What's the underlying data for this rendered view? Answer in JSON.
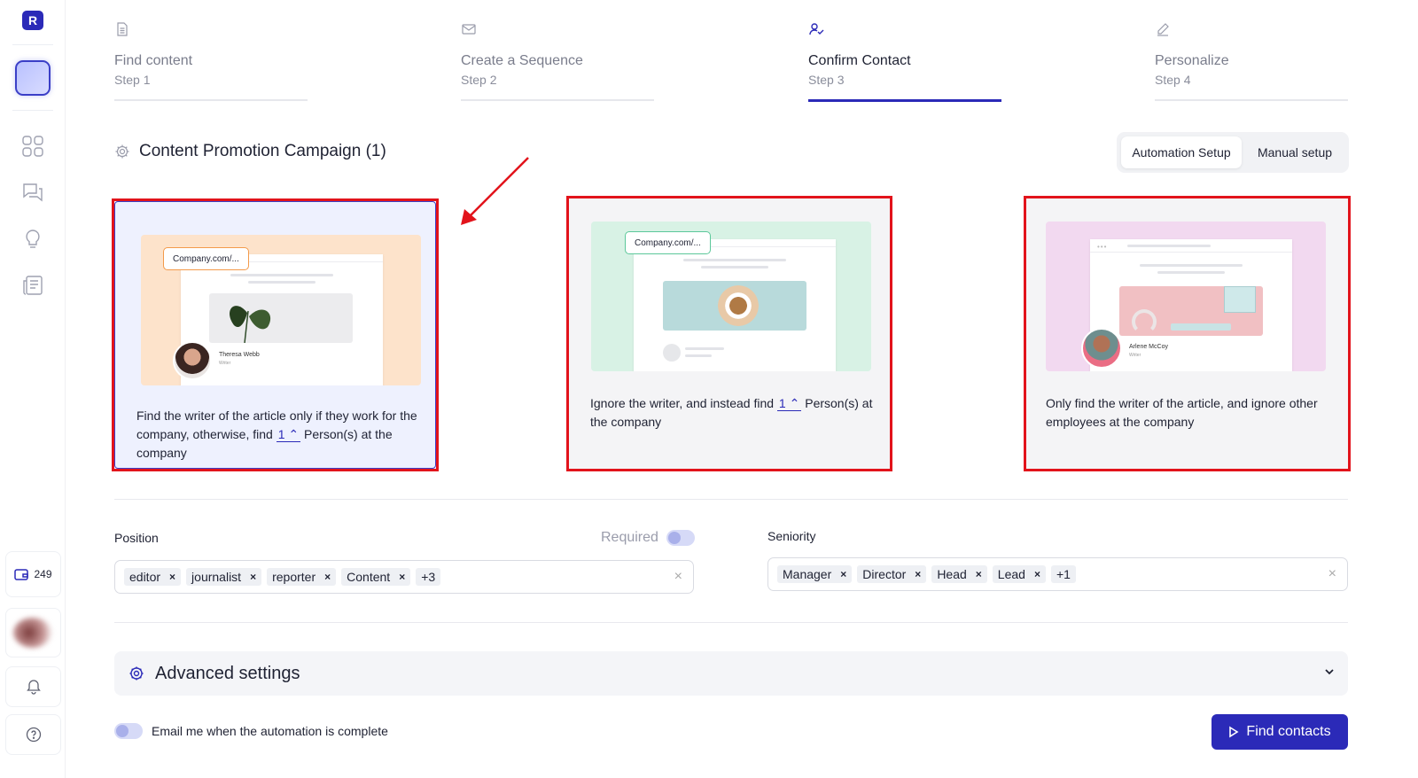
{
  "sidebar": {
    "logo": "R",
    "icons": [
      "grid-icon",
      "chat-icon",
      "lightbulb-icon",
      "newspaper-icon"
    ],
    "credits": "249"
  },
  "steps": [
    {
      "title": "Find content",
      "sub": "Step 1",
      "icon": "document-icon",
      "active": false
    },
    {
      "title": "Create a Sequence",
      "sub": "Step 2",
      "icon": "mail-icon",
      "active": false
    },
    {
      "title": "Confirm Contact",
      "sub": "Step 3",
      "icon": "user-check-icon",
      "active": true
    },
    {
      "title": "Personalize",
      "sub": "Step 4",
      "icon": "pencil-icon",
      "active": false
    }
  ],
  "campaign": {
    "title": "Content Promotion Campaign (1)"
  },
  "setup": {
    "automation": "Automation Setup",
    "manual": "Manual setup"
  },
  "cards": [
    {
      "url": "Company.com/...",
      "writer_name": "Theresa Webb",
      "writer_role": "Writer",
      "text_a": "Find the writer of the article only if they work for the company, otherwise, find",
      "count": "1",
      "text_b": "Person(s) at the company"
    },
    {
      "url": "Company.com/...",
      "text_a": "Ignore the writer, and instead find",
      "count": "1",
      "text_b": "Person(s) at the company"
    },
    {
      "writer_name": "Arlene McCoy",
      "writer_role": "Writer",
      "text_a": "Only find the writer of the article, and ignore other employees at the company"
    }
  ],
  "position": {
    "label": "Position",
    "required_label": "Required",
    "tags": [
      "editor",
      "journalist",
      "reporter",
      "Content"
    ],
    "more": "+3"
  },
  "seniority": {
    "label": "Seniority",
    "tags": [
      "Manager",
      "Director",
      "Head",
      "Lead"
    ],
    "more": "+1"
  },
  "advanced": {
    "title": "Advanced settings"
  },
  "email_toggle": {
    "label": "Email me when the automation is complete"
  },
  "find_button": {
    "label": "Find contacts"
  },
  "colors": {
    "accent": "#2b2ab8",
    "annotation": "#e2131b"
  }
}
